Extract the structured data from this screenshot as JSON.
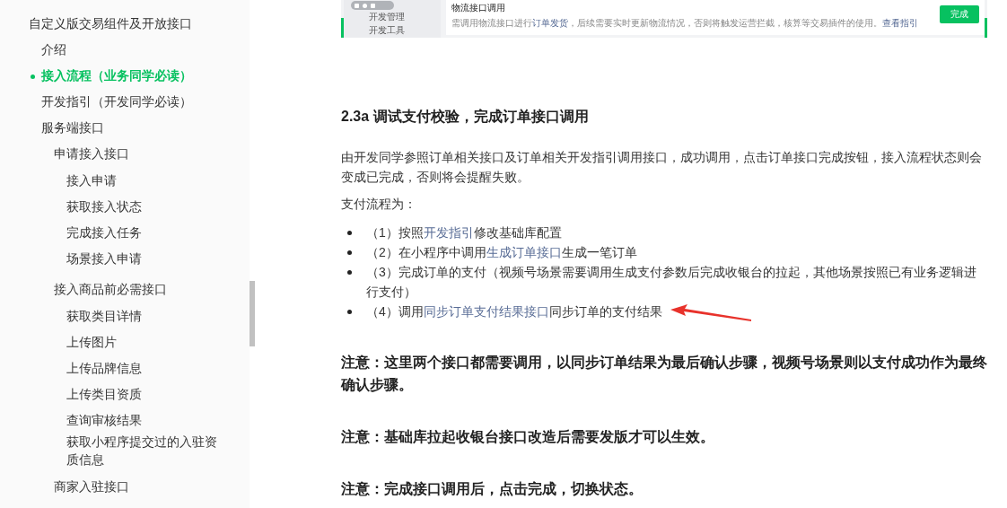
{
  "sidebar": {
    "items": [
      {
        "label": "自定义版交易组件及开放接口",
        "selected": false,
        "children": [
          {
            "label": "介绍",
            "selected": false
          },
          {
            "label": "接入流程（业务同学必读）",
            "selected": true
          },
          {
            "label": "开发指引（开发同学必读）",
            "selected": false
          },
          {
            "label": "服务端接口",
            "selected": false,
            "children": [
              {
                "label": "申请接入接口",
                "selected": false,
                "children": [
                  {
                    "label": "接入申请",
                    "selected": false
                  },
                  {
                    "label": "获取接入状态",
                    "selected": false
                  },
                  {
                    "label": "完成接入任务",
                    "selected": false
                  },
                  {
                    "label": "场景接入申请",
                    "selected": false
                  }
                ]
              },
              {
                "label": "接入商品前必需接口",
                "selected": false,
                "children": [
                  {
                    "label": "获取类目详情",
                    "selected": false
                  },
                  {
                    "label": "上传图片",
                    "selected": false
                  },
                  {
                    "label": "上传品牌信息",
                    "selected": false
                  },
                  {
                    "label": "上传类目资质",
                    "selected": false
                  },
                  {
                    "label": "查询审核结果",
                    "selected": false
                  },
                  {
                    "label": "获取小程序提交过的入驻资质信息",
                    "selected": false
                  }
                ]
              },
              {
                "label": "商家入驻接口",
                "selected": false
              }
            ]
          }
        ]
      }
    ]
  },
  "embedded_screenshot": {
    "menu": [
      "开发管理",
      "开发工具"
    ],
    "title": "物流接口调用",
    "description": [
      {
        "kind": "text",
        "text": "需调用物流接口进行"
      },
      {
        "kind": "link",
        "text": "订单发货"
      },
      {
        "kind": "text",
        "text": "，后续需要实时更新物流情况，否则将触发运营拦截，核算等交易插件的使用。"
      },
      {
        "kind": "link",
        "text": "查看指引"
      }
    ],
    "button": "完成"
  },
  "article": {
    "heading": "2.3a 调试支付校验，完成订单接口调用",
    "paragraphs": [
      "由开发同学参照订单相关接口及订单相关开发指引调用接口，成功调用，点击订单接口完成按钮，接入流程状态则会变成已完成，否则将会提醒失败。",
      "支付流程为："
    ],
    "steps": [
      [
        {
          "kind": "text",
          "text": "（1）按照"
        },
        {
          "kind": "link",
          "text": "开发指引"
        },
        {
          "kind": "text",
          "text": "修改基础库配置"
        }
      ],
      [
        {
          "kind": "text",
          "text": "（2）在小程序中调用"
        },
        {
          "kind": "link",
          "text": "生成订单接口"
        },
        {
          "kind": "text",
          "text": "生成一笔订单"
        }
      ],
      [
        {
          "kind": "text",
          "text": "（3）完成订单的支付（视频号场景需要调用生成支付参数后完成收银台的拉起，其他场景按照已有业务逻辑进行支付）"
        }
      ],
      [
        {
          "kind": "text",
          "text": "（4）调用"
        },
        {
          "kind": "link",
          "text": "同步订单支付结果接口"
        },
        {
          "kind": "text",
          "text": "同步订单的支付结果"
        }
      ]
    ],
    "notes": [
      "注意：这里两个接口都需要调用，以同步订单结果为最后确认步骤，视频号场景则以支付成功作为最终确认步骤。",
      "注意：基础库拉起收银台接口改造后需要发版才可以生效。",
      "注意：完成接口调用后，点击完成，切换状态。"
    ]
  }
}
